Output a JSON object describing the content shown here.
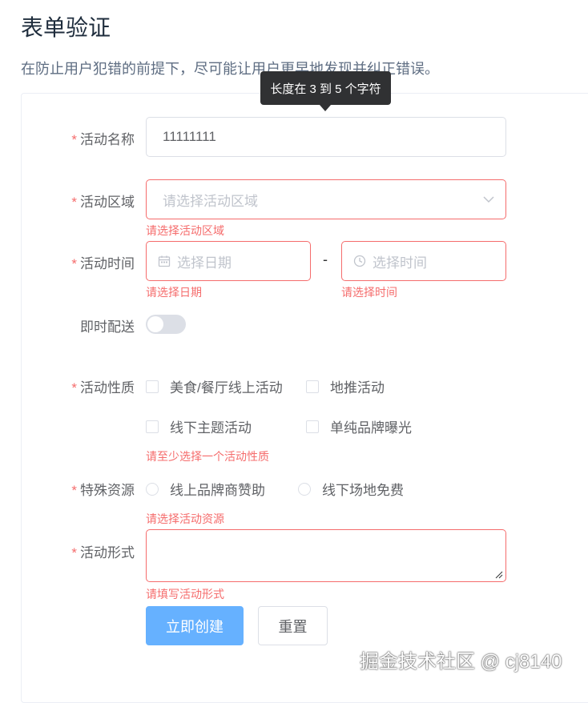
{
  "header": {
    "title": "表单验证",
    "description": "在防止用户犯错的前提下，尽可能让用户更早地发现并纠正错误。"
  },
  "tooltip": {
    "text": "长度在 3 到 5 个字符"
  },
  "form": {
    "required_mark": "*",
    "name": {
      "label": "活动名称",
      "value": "11111111"
    },
    "region": {
      "label": "活动区域",
      "placeholder": "请选择活动区域",
      "error": "请选择活动区域",
      "icon": "chevron-down-icon"
    },
    "time": {
      "label": "活动时间",
      "date_placeholder": "选择日期",
      "date_error": "请选择日期",
      "separator": "-",
      "time_placeholder": "选择时间",
      "time_error": "请选择时间",
      "date_icon": "calendar-icon",
      "time_icon": "clock-icon"
    },
    "delivery": {
      "label": "即时配送",
      "on": false
    },
    "type": {
      "label": "活动性质",
      "options": [
        "美食/餐厅线上活动",
        "地推活动",
        "线下主题活动",
        "单纯品牌曝光"
      ],
      "error": "请至少选择一个活动性质"
    },
    "resource": {
      "label": "特殊资源",
      "options": [
        "线上品牌商赞助",
        "线下场地免费"
      ],
      "error": "请选择活动资源"
    },
    "desc": {
      "label": "活动形式",
      "value": "",
      "error": "请填写活动形式"
    },
    "buttons": {
      "submit": "立即创建",
      "reset": "重置"
    }
  },
  "watermark": "掘金技术社区 @ cj8140",
  "colors": {
    "error": "#f56c6c",
    "primary": "#66b1ff",
    "border": "#dcdfe6",
    "tooltip_bg": "#303133"
  }
}
